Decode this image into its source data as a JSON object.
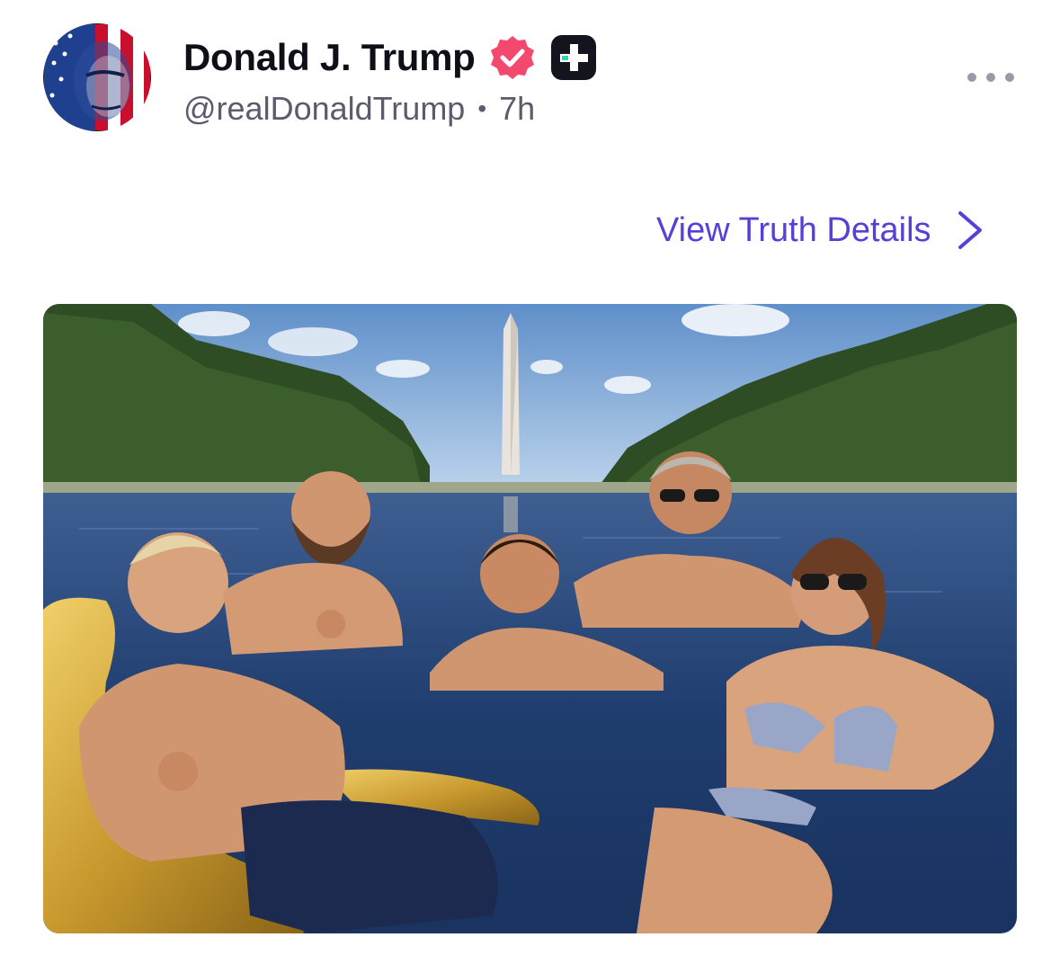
{
  "post": {
    "author": {
      "display_name": "Donald J. Trump",
      "handle": "@realDonaldTrump",
      "timestamp": "7h",
      "separator": "•",
      "avatar_icon": "flag-portrait-avatar",
      "verified_icon": "verified-badge-icon",
      "plus_icon": "truth-plus-badge-icon"
    },
    "more_icon": "more-horizontal-icon",
    "view_details": {
      "label": "View Truth Details",
      "icon": "chevron-right-icon"
    },
    "media": {
      "kind": "photo"
    }
  },
  "colors": {
    "accent": "#5541d9",
    "verified": "#f4486f",
    "text_primary": "#0f0f1a",
    "text_secondary": "#5b5b6b",
    "plus_badge": "#14141f"
  }
}
